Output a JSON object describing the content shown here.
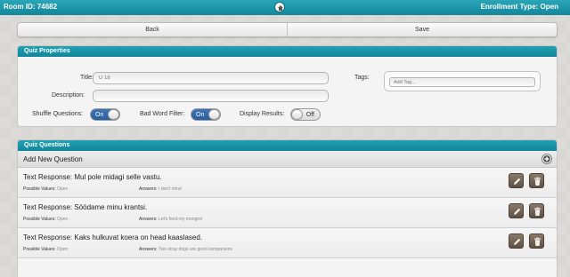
{
  "topbar": {
    "room_label": "Room ID:",
    "room_id": "74682",
    "enrollment_label": "Enrollment Type:",
    "enrollment_value": "Open"
  },
  "toolbar": {
    "back_label": "Back",
    "save_label": "Save"
  },
  "props": {
    "header": "Quiz Properties",
    "title_label": "Title:",
    "title_value": "U 18",
    "description_label": "Description:",
    "description_value": "",
    "tags_label": "Tags:",
    "tag_placeholder": "Add Tag...",
    "shuffle_label": "Shuffle Questions:",
    "shuffle_state": "On",
    "badword_label": "Bad Word Filter:",
    "badword_state": "On",
    "display_label": "Display Results:",
    "display_state": "Off"
  },
  "questions": {
    "header": "Quiz Questions",
    "add_label": "Add New Question",
    "possible_label": "Possible Values:",
    "answers_label": "Answers:",
    "items": [
      {
        "title": "Text Response: Mul pole midagi selle vastu.",
        "possible": "Open",
        "answer": "I don't mind"
      },
      {
        "title": "Text Response: Söödame minu krantsi.",
        "possible": "Open",
        "answer": "Let's feed my mongrel"
      },
      {
        "title": "Text Response: Kaks hulkuvat koera on head kaaslased.",
        "possible": "Open",
        "answer": "Two stray dogs are good companions"
      }
    ]
  },
  "colors": {
    "accent": "#1592a6",
    "toggle_on": "#3566a8",
    "action_button": "#6e5f52"
  },
  "icons": [
    "home-icon",
    "plus-circle-icon",
    "edit-pencil-icon",
    "trash-icon"
  ]
}
